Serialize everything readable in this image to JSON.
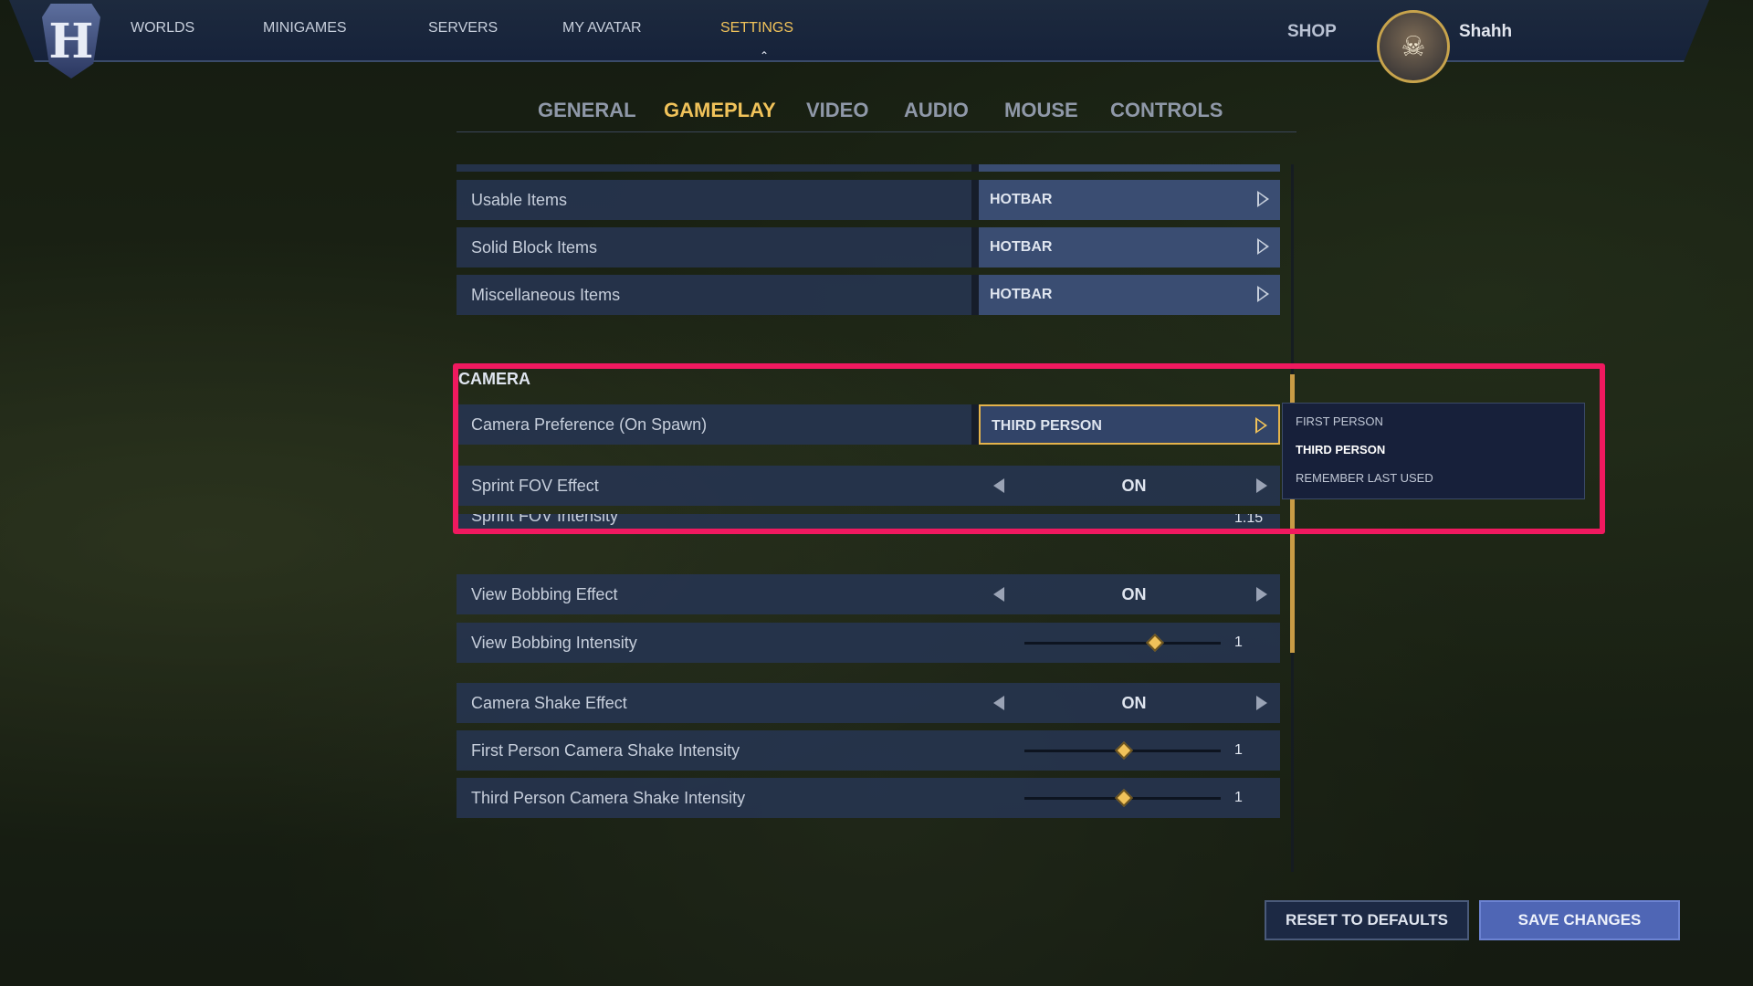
{
  "nav": {
    "items": [
      "WORLDS",
      "MINIGAMES",
      "SERVERS",
      "MY AVATAR",
      "SETTINGS"
    ],
    "active": "SETTINGS",
    "shop": "SHOP",
    "username": "Shahh"
  },
  "tabs": {
    "items": [
      "GENERAL",
      "GAMEPLAY",
      "VIDEO",
      "AUDIO",
      "MOUSE",
      "CONTROLS"
    ],
    "active": "GAMEPLAY"
  },
  "inventory_rows": [
    {
      "label": "Usable Items",
      "value": "HOTBAR"
    },
    {
      "label": "Solid Block Items",
      "value": "HOTBAR"
    },
    {
      "label": "Miscellaneous Items",
      "value": "HOTBAR"
    }
  ],
  "camera": {
    "section_title": "CAMERA",
    "preference": {
      "label": "Camera Preference (On Spawn)",
      "value": "THIRD PERSON"
    },
    "sprint_fov": {
      "label": "Sprint FOV Effect",
      "value": "ON"
    },
    "sprint_fov_intensity": {
      "label": "Sprint FOV Intensity",
      "value": "1.15"
    },
    "view_bobbing": {
      "label": "View Bobbing Effect",
      "value": "ON"
    },
    "view_bobbing_intensity": {
      "label": "View Bobbing Intensity",
      "value": "1",
      "fraction": 0.66
    },
    "camera_shake": {
      "label": "Camera Shake Effect",
      "value": "ON"
    },
    "first_person_shake": {
      "label": "First Person Camera Shake Intensity",
      "value": "1",
      "fraction": 0.5
    },
    "third_person_shake": {
      "label": "Third Person Camera Shake Intensity",
      "value": "1",
      "fraction": 0.5
    }
  },
  "dropdown": {
    "options": [
      "FIRST PERSON",
      "THIRD PERSON",
      "REMEMBER LAST USED"
    ],
    "selected": "THIRD PERSON"
  },
  "buttons": {
    "reset": "RESET TO DEFAULTS",
    "save": "SAVE CHANGES"
  },
  "colors": {
    "accent": "#f0c25a",
    "highlight": "#f0195f",
    "save_button": "#4f66b5"
  }
}
